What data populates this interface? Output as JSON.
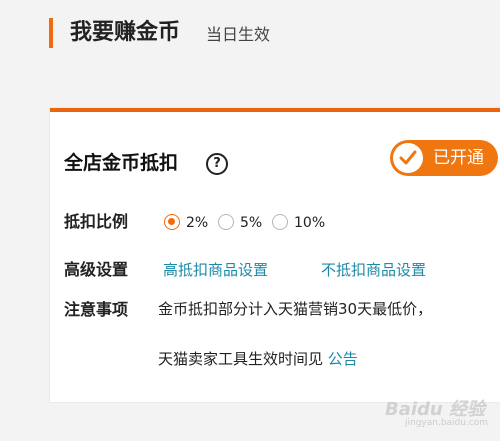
{
  "header": {
    "title": "我要赚金币",
    "subtitle": "当日生效"
  },
  "card": {
    "title": "全店金币抵扣",
    "help_icon": "question-circle-icon",
    "toggle": {
      "label": "已开通",
      "state": "on",
      "color": "#f0760f"
    },
    "ratio": {
      "label": "抵扣比例",
      "options": [
        "2%",
        "5%",
        "10%"
      ],
      "selected": "2%"
    },
    "advanced": {
      "label": "高级设置",
      "links": [
        "高抵扣商品设置",
        "不抵扣商品设置"
      ]
    },
    "notes": {
      "label": "注意事项",
      "line1": "金币抵扣部分计入天猫营销30天最低价，",
      "line2_prefix": "天猫卖家工具生效时间见",
      "line2_link": "公告"
    }
  },
  "watermark": {
    "text": "Baidu 经验",
    "sub": "jingyan.baidu.com"
  },
  "colors": {
    "accent": "#f06a0f",
    "link": "#1d8aa8"
  }
}
